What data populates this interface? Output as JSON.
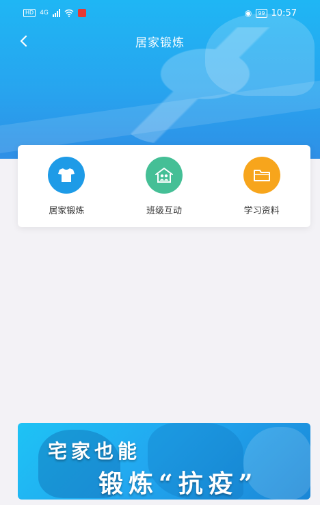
{
  "status_bar": {
    "network": "4G",
    "hd": "HD",
    "battery": "99",
    "time": "10:57"
  },
  "header": {
    "title": "居家锻炼"
  },
  "menu": {
    "items": [
      {
        "label": "居家锻炼",
        "color": "#1e9be7",
        "icon": "tshirt-icon"
      },
      {
        "label": "班级互动",
        "color": "#45bf96",
        "icon": "class-people-icon"
      },
      {
        "label": "学习资料",
        "color": "#f7a51c",
        "icon": "folder-icon"
      }
    ]
  },
  "banner": {
    "line1": "宅家也能",
    "line2": "锻炼“抗疫”"
  }
}
